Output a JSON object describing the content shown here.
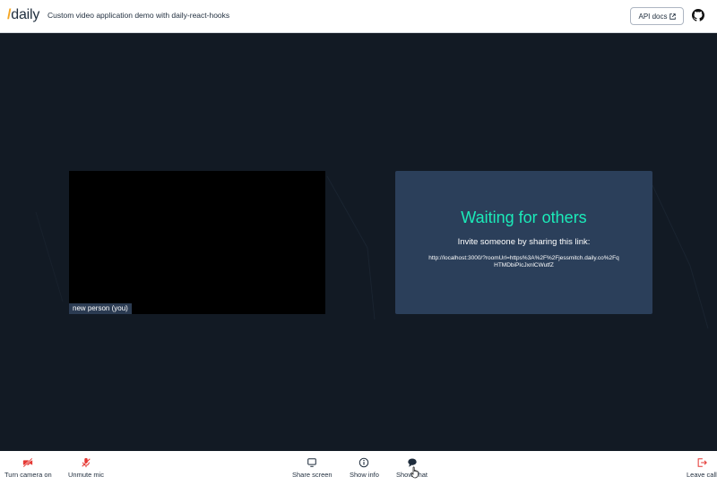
{
  "header": {
    "logo_slash": "/",
    "logo_text": "daily",
    "subtitle": "Custom video application demo with daily-react-hooks",
    "api_docs_label": "API docs"
  },
  "local_tile": {
    "name": "new person (you)"
  },
  "waiting_tile": {
    "title": "Waiting for others",
    "subtitle": "Invite someone by sharing this link:",
    "link": "http://localhost:3000/?roomUrl=https%3A%2F%2Fjessmitch.daily.co%2FqHTMDbiPIcJxnlCWutfZ"
  },
  "tray": {
    "camera_label": "Turn camera on",
    "mic_label": "Unmute mic",
    "share_label": "Share screen",
    "info_label": "Show info",
    "chat_label": "Show chat",
    "leave_label": "Leave call"
  },
  "colors": {
    "accent_teal": "#1bebb9",
    "logo_orange": "#f5a623",
    "muted_red": "#e53935",
    "stage_bg": "#121a24",
    "tile_bg": "#2b3f5a"
  },
  "icons": {
    "camera": "camera-off-icon",
    "mic": "mic-off-icon",
    "share": "monitor-icon",
    "info": "info-icon",
    "chat": "chat-bubble-icon",
    "leave": "leave-icon",
    "github": "github-icon",
    "external": "external-link-icon"
  }
}
